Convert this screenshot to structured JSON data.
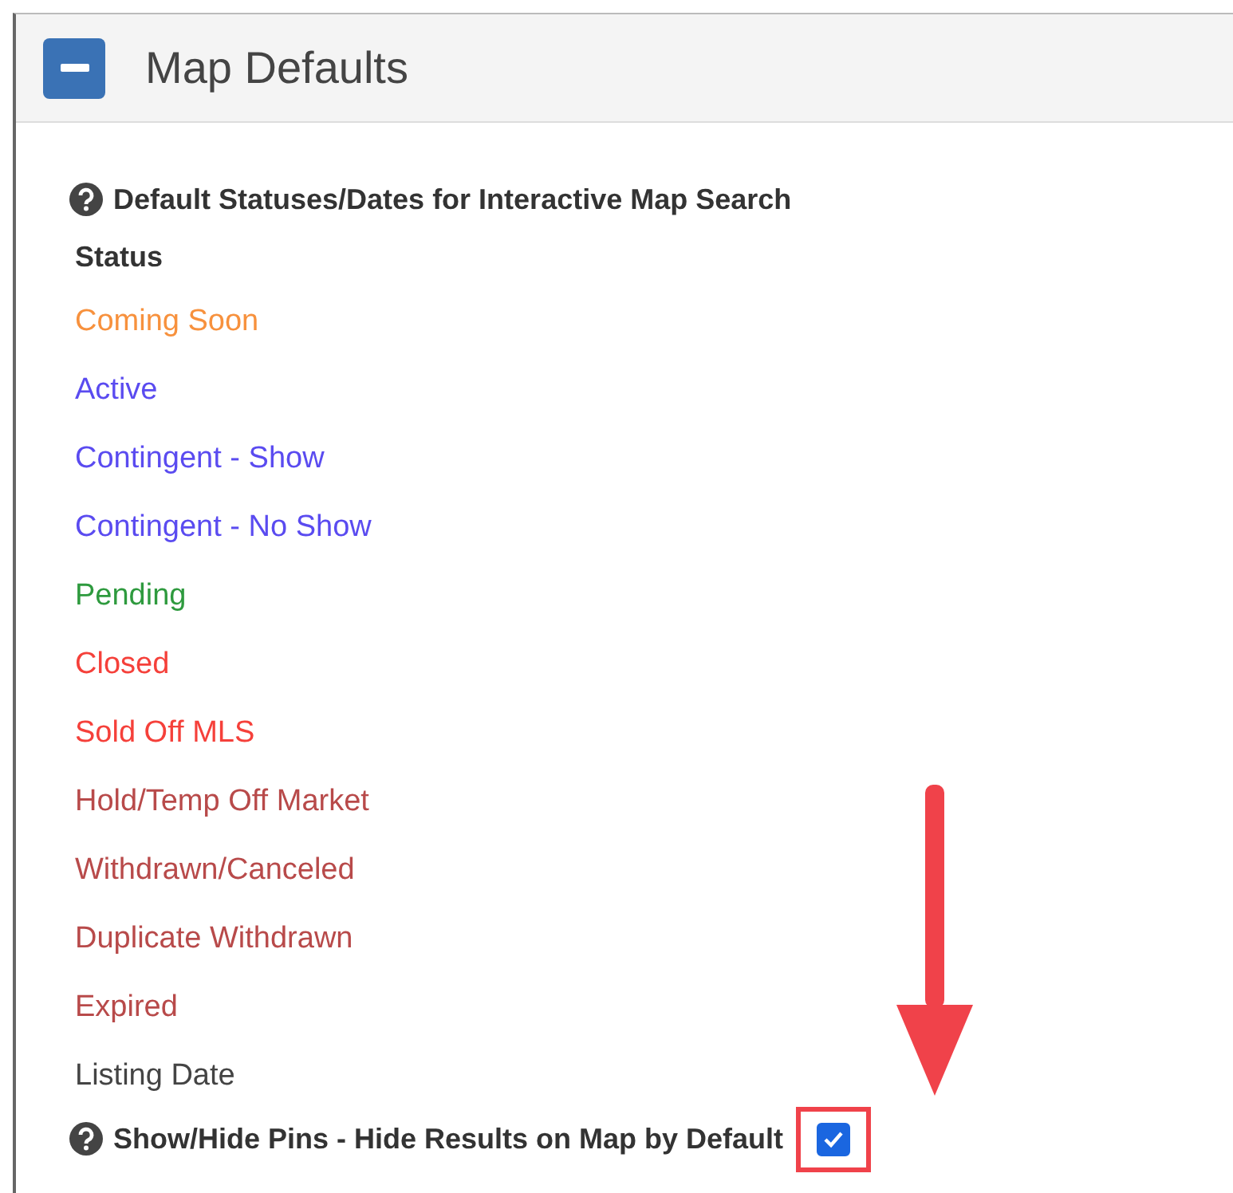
{
  "panel": {
    "title": "Map Defaults",
    "expanded": true
  },
  "statuses_heading": "Default Statuses/Dates for Interactive Map Search",
  "status_label": "Status",
  "statuses": [
    {
      "label": "Coming Soon",
      "color": "#f7913d"
    },
    {
      "label": "Active",
      "color": "#5a4bf0"
    },
    {
      "label": "Contingent - Show",
      "color": "#5a4bf0"
    },
    {
      "label": "Contingent - No Show",
      "color": "#5a4bf0"
    },
    {
      "label": "Pending",
      "color": "#2e9a3e"
    },
    {
      "label": "Closed",
      "color": "#f5403a"
    },
    {
      "label": "Sold Off MLS",
      "color": "#f5403a"
    },
    {
      "label": "Hold/Temp Off Market",
      "color": "#b84a4a"
    },
    {
      "label": "Withdrawn/Canceled",
      "color": "#b84a4a"
    },
    {
      "label": "Duplicate Withdrawn",
      "color": "#b84a4a"
    },
    {
      "label": "Expired",
      "color": "#b84a4a"
    },
    {
      "label": "Listing Date",
      "color": "#444444"
    }
  ],
  "hide_pins": {
    "label": "Show/Hide Pins - Hide Results on Map by Default",
    "checked": true,
    "highlighted": true
  }
}
